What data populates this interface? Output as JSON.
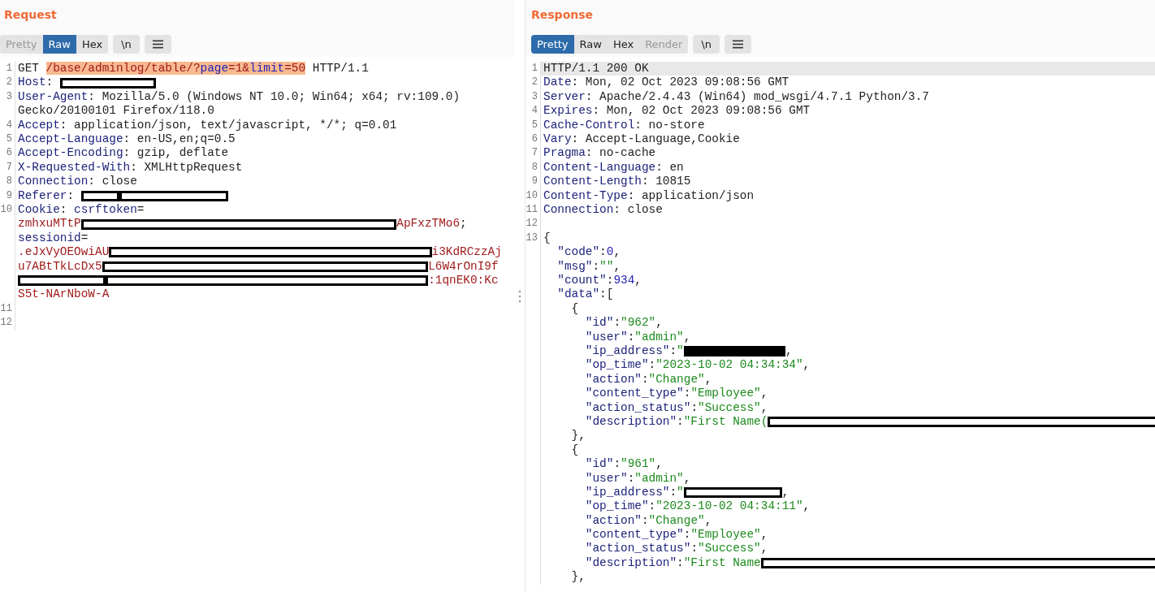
{
  "request": {
    "title": "Request",
    "tabs": [
      {
        "label": "Pretty",
        "selected": false,
        "disabled": true
      },
      {
        "label": "Raw",
        "selected": true,
        "disabled": false
      },
      {
        "label": "Hex",
        "selected": false,
        "disabled": false
      }
    ],
    "newline_button": "\\n",
    "lines": [
      {
        "n": "1",
        "kind": "request_line",
        "current": false,
        "rows": [
          "GET /base/adminlog/table/?page=1&limit=50 HTTP/1.1"
        ]
      },
      {
        "n": "2",
        "kind": "header",
        "current": false,
        "rows": [
          {
            "text": "Host: ",
            "redacted": [
              {
                "filled": false
              }
            ]
          }
        ]
      },
      {
        "n": "3",
        "kind": "header",
        "current": false,
        "rows": [
          "User-Agent: Mozilla/5.0 (Windows NT 10.0; Win64; x64; rv:109.0)",
          "Gecko/20100101 Firefox/118.0"
        ]
      },
      {
        "n": "4",
        "kind": "header",
        "current": false,
        "rows": [
          "Accept: application/json, text/javascript, */*; q=0.01"
        ]
      },
      {
        "n": "5",
        "kind": "header",
        "current": false,
        "rows": [
          "Accept-Language: en-US,en;q=0.5"
        ]
      },
      {
        "n": "6",
        "kind": "header",
        "current": false,
        "rows": [
          "Accept-Encoding: gzip, deflate"
        ]
      },
      {
        "n": "7",
        "kind": "header",
        "current": false,
        "rows": [
          "X-Requested-With: XMLHttpRequest"
        ]
      },
      {
        "n": "8",
        "kind": "header",
        "current": false,
        "rows": [
          "Connection: close"
        ]
      },
      {
        "n": "9",
        "kind": "header",
        "current": false,
        "rows": [
          {
            "text": "Referer: ",
            "redacted": [
              {
                "filled": false
              },
              {
                "filled": false
              }
            ]
          }
        ]
      },
      {
        "n": "10",
        "kind": "cookie",
        "current": false,
        "rows": [
          "Cookie: csrftoken=",
          {
            "text": "zmhxuMTtP",
            "redacted": [
              {
                "filled": false
              }
            ],
            "text_after": "ApFxzTMo6;"
          },
          "sessionid=",
          {
            "text": ".eJxVyOEOwiAU",
            "redacted": [
              {
                "filled": false
              }
            ],
            "text_after": "i3KdRCzzAj"
          },
          {
            "text": "u7ABtTkLcDx5",
            "redacted": [
              {
                "filled": false
              }
            ],
            "text_after": "L6W4rOnI9f"
          },
          {
            "redacted": [
              {
                "filled": false
              },
              {
                "filled": false
              }
            ],
            "text_after": ":1qnEK0:Kc"
          },
          "S5t-NArNboW-A"
        ]
      },
      {
        "n": "11",
        "current": false
      },
      {
        "n": "12",
        "current": false
      }
    ]
  },
  "response": {
    "title": "Response",
    "tabs": [
      {
        "label": "Pretty",
        "selected": true,
        "disabled": false
      },
      {
        "label": "Raw",
        "selected": false,
        "disabled": false
      },
      {
        "label": "Hex",
        "selected": false,
        "disabled": false
      },
      {
        "label": "Render",
        "selected": false,
        "disabled": true
      }
    ],
    "newline_button": "\\n",
    "lines": [
      {
        "n": "1",
        "kind": "status",
        "current": true,
        "rows": [
          "HTTP/1.1 200 OK"
        ]
      },
      {
        "n": "2",
        "kind": "header",
        "current": false,
        "rows": [
          "Date: Mon, 02 Oct 2023 09:08:56 GMT"
        ]
      },
      {
        "n": "3",
        "kind": "header",
        "current": false,
        "rows": [
          "Server: Apache/2.4.43 (Win64) mod_wsgi/4.7.1 Python/3.7"
        ]
      },
      {
        "n": "4",
        "kind": "header",
        "current": false,
        "rows": [
          "Expires: Mon, 02 Oct 2023 09:08:56 GMT"
        ]
      },
      {
        "n": "5",
        "kind": "header",
        "current": false,
        "rows": [
          "Cache-Control: no-store"
        ]
      },
      {
        "n": "6",
        "kind": "header",
        "current": false,
        "rows": [
          "Vary: Accept-Language,Cookie"
        ]
      },
      {
        "n": "7",
        "kind": "header",
        "current": false,
        "rows": [
          "Pragma: no-cache"
        ]
      },
      {
        "n": "8",
        "kind": "header",
        "current": false,
        "rows": [
          "Content-Language: en"
        ]
      },
      {
        "n": "9",
        "kind": "header",
        "current": false,
        "rows": [
          "Content-Length: 10815"
        ]
      },
      {
        "n": "10",
        "kind": "header",
        "current": false,
        "rows": [
          "Content-Type: application/json"
        ]
      },
      {
        "n": "11",
        "kind": "header",
        "current": false,
        "rows": [
          "Connection: close"
        ]
      },
      {
        "n": "12",
        "current": false
      },
      {
        "n": "13",
        "kind": "json",
        "current": false,
        "rows": [
          "{",
          "  \"code\":0,",
          "  \"msg\":\"\",",
          "  \"count\":934,",
          "  \"data\":[",
          "    {",
          "      \"id\":\"962\",",
          "      \"user\":\"admin\",",
          {
            "text": "      \"ip_address\":\"",
            "redacted": [
              {
                "filled": true
              }
            ],
            "text_after": ","
          },
          "      \"op_time\":\"2023-10-02 04:34:34\",",
          "      \"action\":\"Change\",",
          "      \"content_type\":\"Employee\",",
          "      \"action_status\":\"Success\",",
          {
            "text": "      \"description\":\"First Name(",
            "redacted": [
              {
                "filled": false
              }
            ]
          },
          "    },",
          "    {",
          "      \"id\":\"961\",",
          "      \"user\":\"admin\",",
          {
            "text": "      \"ip_address\":\"",
            "redacted": [
              {
                "filled": false
              }
            ],
            "text_after": ","
          },
          "      \"op_time\":\"2023-10-02 04:34:11\",",
          "      \"action\":\"Change\",",
          "      \"content_type\":\"Employee\",",
          "      \"action_status\":\"Success\",",
          {
            "text": "      \"description\":\"First Name",
            "redacted": [
              {
                "filled": false
              }
            ]
          },
          "    },"
        ]
      }
    ]
  }
}
